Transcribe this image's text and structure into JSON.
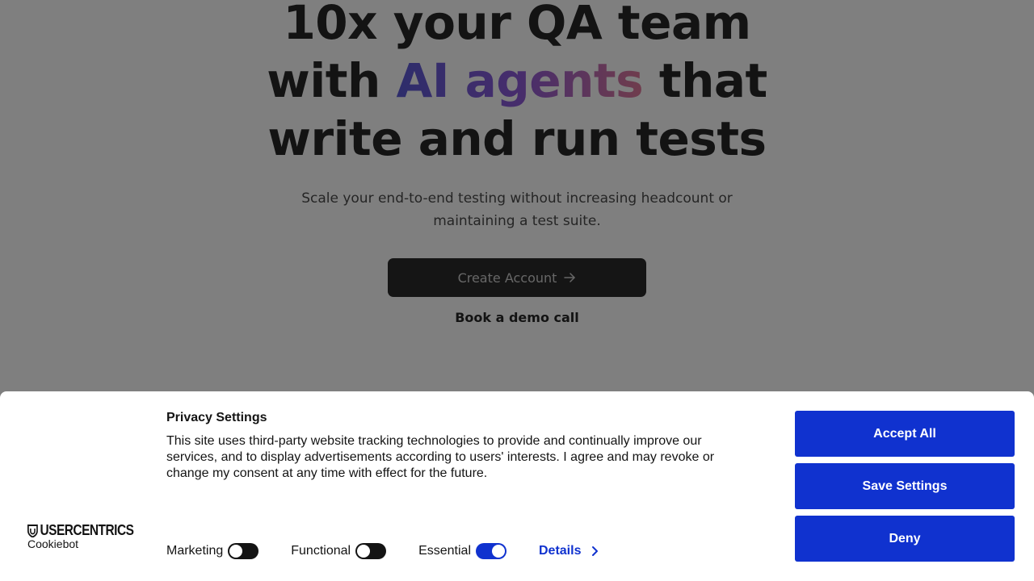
{
  "hero": {
    "headline_line1": "10x your QA team",
    "headline_with": "with",
    "headline_highlight": "AI agents",
    "headline_that": "that",
    "headline_line3": "write and run tests",
    "subheadline": "Scale your end-to-end testing without increasing headcount or maintaining a test suite.",
    "cta_label": "Create Account",
    "demo_link": "Book a demo call"
  },
  "cookie_banner": {
    "brand_name": "USERCENTRICS",
    "brand_sub": "Cookiebot",
    "title": "Privacy Settings",
    "text": "This site uses third-party website tracking technologies to provide and continually improve our services, and to display advertisements according to users' interests. I agree and may revoke or change my consent at any time with effect for the future.",
    "toggles": [
      {
        "label": "Marketing",
        "on": false
      },
      {
        "label": "Functional",
        "on": false
      },
      {
        "label": "Essential",
        "on": true
      }
    ],
    "details_label": "Details",
    "accept_all_label": "Accept All",
    "save_settings_label": "Save Settings",
    "deny_label": "Deny"
  },
  "colors": {
    "accent": "#1032cf",
    "overlay": "rgba(0,0,0,0.5)",
    "headline_gradient": [
      "#5b5bd6",
      "#8e5ad8",
      "#e07a9a"
    ]
  },
  "icons": {
    "cta_arrow": "arrow-right-icon",
    "details_chevron": "chevron-right-icon",
    "brand_shield": "shield-icon"
  }
}
